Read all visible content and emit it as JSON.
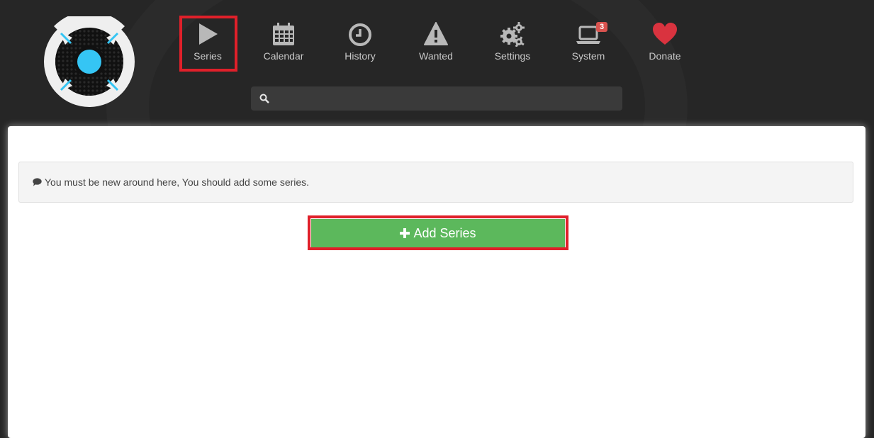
{
  "nav": {
    "items": [
      {
        "label": "Series",
        "icon": "play-icon"
      },
      {
        "label": "Calendar",
        "icon": "calendar-icon"
      },
      {
        "label": "History",
        "icon": "clock-icon"
      },
      {
        "label": "Wanted",
        "icon": "warning-icon"
      },
      {
        "label": "Settings",
        "icon": "gears-icon"
      },
      {
        "label": "System",
        "icon": "laptop-icon",
        "badge": "3"
      },
      {
        "label": "Donate",
        "icon": "heart-icon"
      }
    ]
  },
  "search": {
    "placeholder": "",
    "value": ""
  },
  "main": {
    "empty_message": "You must be new around here, You should add some series.",
    "add_series_label": "Add Series"
  },
  "colors": {
    "header_bg": "#262626",
    "accent_blue": "#35c5f4",
    "highlight_red": "#e0202a",
    "success_green": "#5cb85c",
    "heart_red": "#d9333f"
  }
}
